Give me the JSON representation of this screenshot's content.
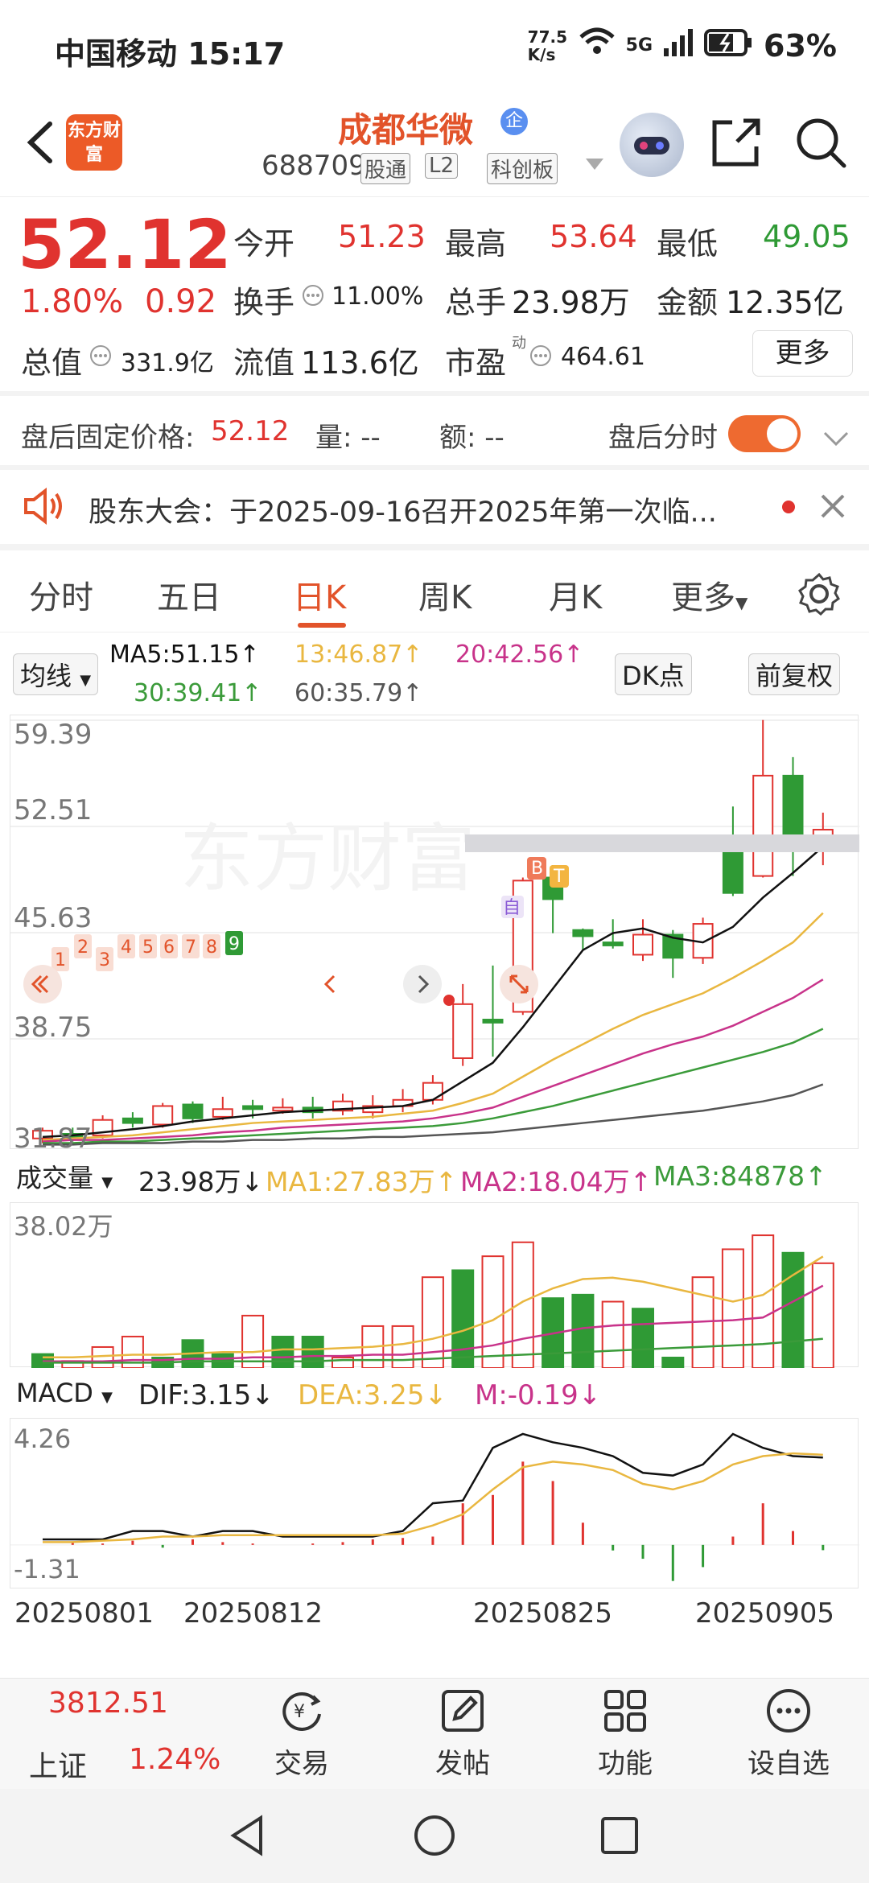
{
  "status": {
    "carrier_time": "中国移动 15:17",
    "net_speed": "77.5 K/s",
    "signal": "5G",
    "battery": "63%"
  },
  "header": {
    "logo_text": "东方财富",
    "name": "成都华微",
    "badge": "企",
    "code": "688709",
    "tags": [
      "股通",
      "L2",
      "科创板"
    ]
  },
  "quote": {
    "price": "52.12",
    "change_pct": "1.80%",
    "change": "0.92",
    "open_label": "今开",
    "open": "51.23",
    "high_label": "最高",
    "high": "53.64",
    "low_label": "最低",
    "low": "49.05",
    "turnover_label": "换手",
    "turnover": "11.00%",
    "volume_label": "总手",
    "volume": "23.98万",
    "amount_label": "金额",
    "amount": "12.35亿",
    "mktcap_label": "总值",
    "mktcap": "331.9亿",
    "float_label": "流值",
    "float": "113.6亿",
    "pe_label": "市盈",
    "pe_sup": "动",
    "pe": "464.61",
    "more": "更多"
  },
  "after_hours": {
    "price_label": "盘后固定价格:",
    "price": "52.12",
    "vol_label": "量: --",
    "amt_label": "额: --",
    "toggle_label": "盘后分时"
  },
  "notice": {
    "text": "股东大会：于2025-09-16召开2025年第一次临..."
  },
  "tabs": [
    "分时",
    "五日",
    "日K",
    "周K",
    "月K",
    "更多"
  ],
  "ma": {
    "selector": "均线",
    "ma5": "MA5:51.15↑",
    "ma13": "13:46.87↑",
    "ma20": "20:42.56↑",
    "ma30": "30:39.41↑",
    "ma60": "60:35.79↑",
    "dk": "DK点",
    "adjust": "前复权"
  },
  "kchart": {
    "y_labels": [
      "59.39",
      "52.51",
      "45.63",
      "38.75",
      "31.87"
    ],
    "markers": [
      "1",
      "2",
      "3",
      "4",
      "5",
      "6",
      "7",
      "8",
      "9"
    ],
    "b_tag": "B",
    "t_tag": "T",
    "zi_tag": "自",
    "watermark": "东方财富"
  },
  "volume": {
    "selector": "成交量",
    "value": "23.98万↓",
    "ma1": "MA1:27.83万↑",
    "ma2": "MA2:18.04万↑",
    "ma3": "MA3:84878↑",
    "max_label": "38.02万"
  },
  "macd": {
    "selector": "MACD",
    "dif": "DIF:3.15↓",
    "dea": "DEA:3.25↓",
    "m": "M:-0.19↓",
    "max_label": "4.26",
    "min_label": "-1.31"
  },
  "dates": [
    "20250801",
    "20250812",
    "20250825",
    "20250905"
  ],
  "bottom": {
    "index_value": "3812.51",
    "index_name": "上证",
    "index_pct": "1.24%",
    "trade": "交易",
    "post": "发帖",
    "func": "功能",
    "watch": "设自选"
  },
  "colors": {
    "up": "#e0332f",
    "down": "#2f9a35",
    "ma5": "#111111",
    "ma13": "#e9b740",
    "ma20": "#c8338a",
    "ma30": "#3b9b3a",
    "ma60": "#555555",
    "brand": "#e2532a"
  }
}
